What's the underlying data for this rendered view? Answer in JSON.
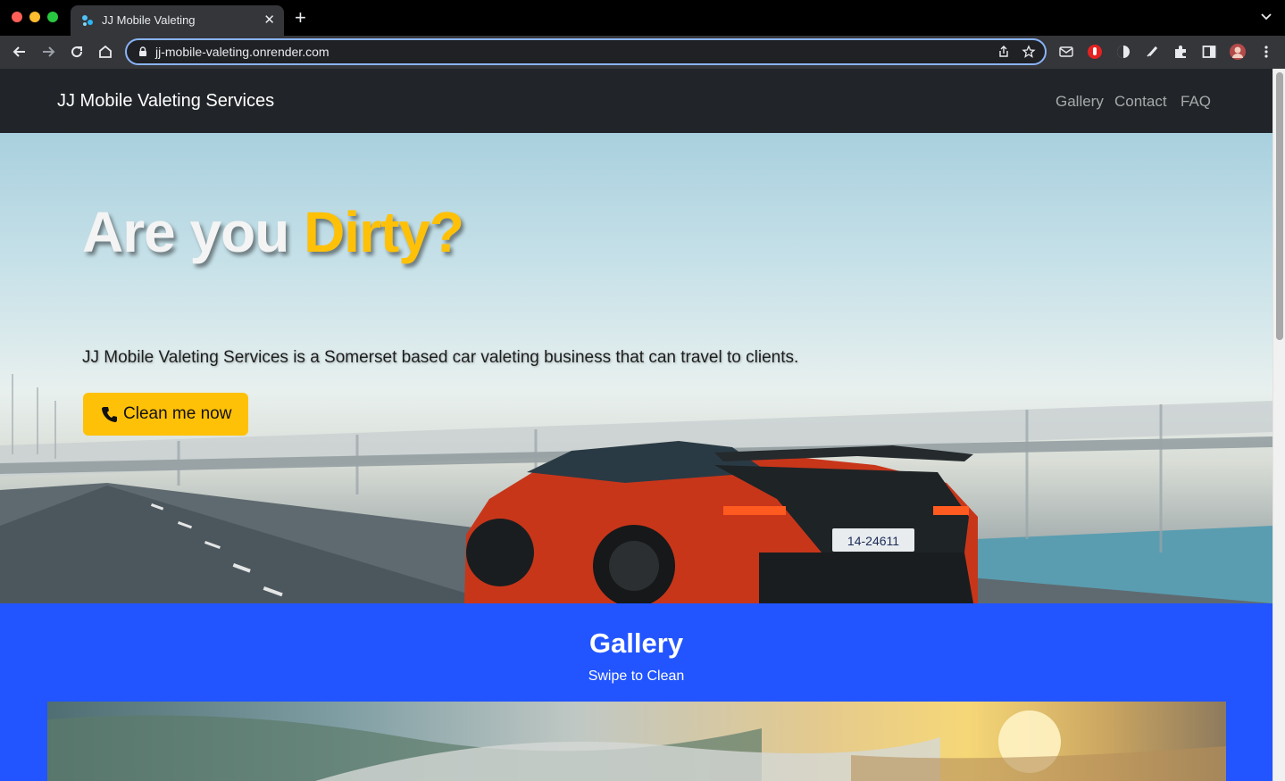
{
  "browser": {
    "tab_title": "JJ Mobile Valeting",
    "url": "jj-mobile-valeting.onrender.com"
  },
  "navbar": {
    "brand": "JJ Mobile Valeting Services",
    "links": [
      "Gallery",
      "Contact",
      "FAQ"
    ]
  },
  "hero": {
    "title_part1": "Are you",
    "title_part2": "Dirty?",
    "description": "JJ Mobile Valeting Services is a Somerset based car valeting business that can travel to clients.",
    "cta_label": "Clean me now",
    "cta_icon": "phone-icon",
    "license_plate": "14-24611",
    "accent_color": "#ffc107"
  },
  "gallery": {
    "title": "Gallery",
    "subtitle": "Swipe to Clean",
    "background_color": "#2255ff"
  },
  "colors": {
    "navbar_bg": "#212529",
    "accent": "#ffc107",
    "gallery_bg": "#2255ff"
  }
}
